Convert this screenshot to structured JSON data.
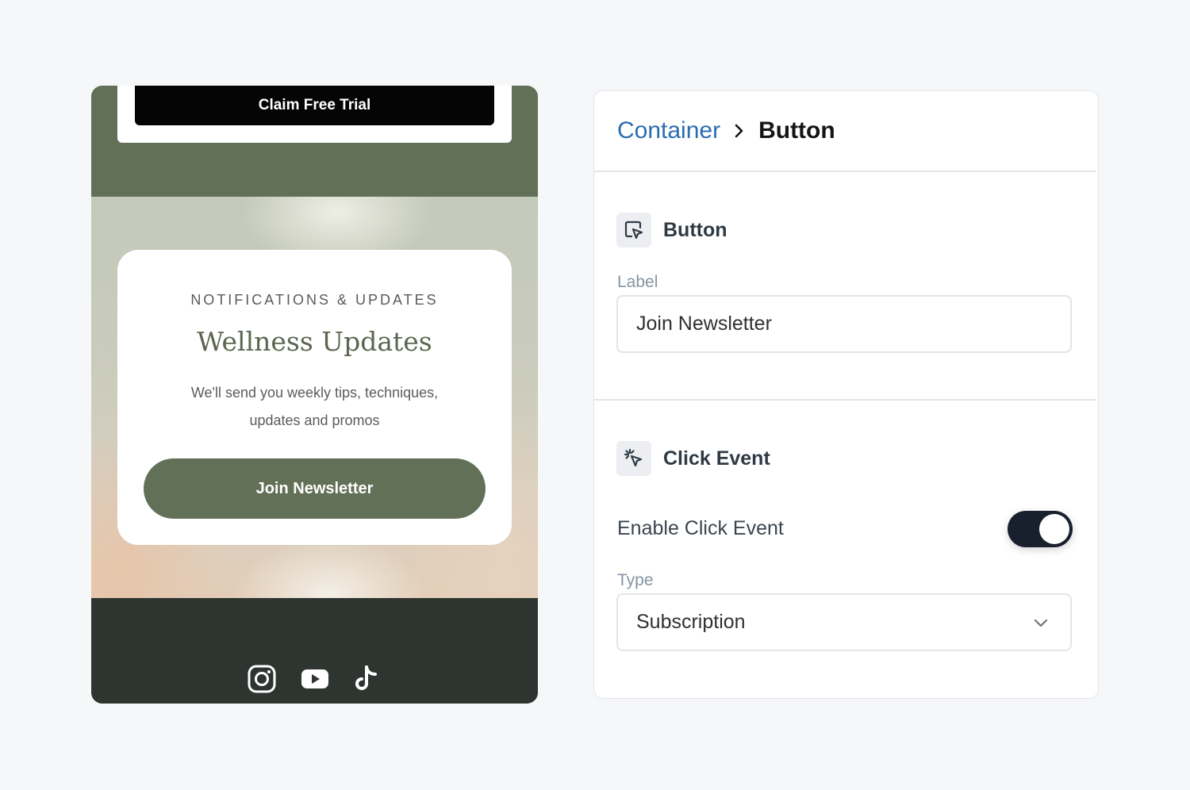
{
  "preview": {
    "trial_button_label": "Claim Free Trial",
    "eyebrow": "NOTIFICATIONS & UPDATES",
    "title": "Wellness Updates",
    "description": "We'll send you weekly tips, techniques, updates and promos",
    "join_button_label": "Join Newsletter",
    "social_icons": [
      "instagram-icon",
      "youtube-icon",
      "tiktok-icon"
    ],
    "colors": {
      "brand_green": "#627058",
      "footer_dark": "#2e3531",
      "trial_black": "#050505"
    }
  },
  "panel": {
    "breadcrumb": {
      "parent": "Container",
      "current": "Button"
    },
    "button_section": {
      "title": "Button",
      "label_field": {
        "label": "Label",
        "value": "Join Newsletter"
      }
    },
    "click_section": {
      "title": "Click Event",
      "toggle_label": "Enable Click Event",
      "toggle_on": true,
      "type_field": {
        "label": "Type",
        "value": "Subscription"
      }
    },
    "colors": {
      "link_blue": "#2b6cb0",
      "toggle_dark": "#17202c"
    }
  }
}
